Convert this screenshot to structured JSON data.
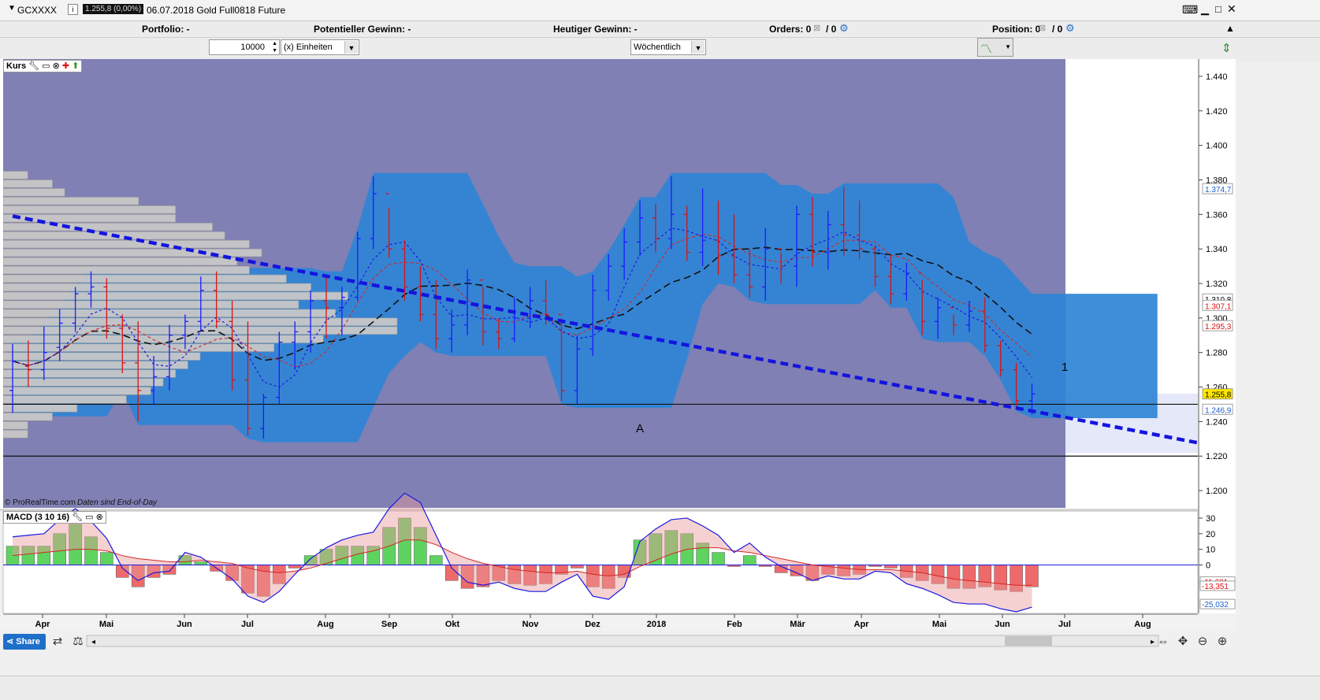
{
  "header": {
    "symbol": "GCXXXX",
    "price_badge": "1.255,8 (0,00%)",
    "instrument": "06.07.2018 Gold Full0818 Future"
  },
  "infobar": {
    "portfolio": "Portfolio: -",
    "potential": "Potentieller Gewinn: -",
    "today": "Heutiger Gewinn: -",
    "orders_label": "Orders: 0",
    "orders_sep": "/ 0",
    "position_label": "Position: 0",
    "position_sep": "/ 0"
  },
  "controls": {
    "quantity": "10000",
    "unit": "(x) Einheiten",
    "interval": "Wöchentlich"
  },
  "price_panel": {
    "label": "Kurs",
    "copyright": "© ProRealTime.com",
    "eod_note": "Daten sind End-of-Day",
    "annotation_a": "A",
    "annotation_1": "1"
  },
  "macd_panel": {
    "label": "MACD (3 10 16)"
  },
  "bottom": {
    "share": "Share"
  },
  "colors": {
    "chart_bg": "#8080b4",
    "cloud": "#2f84d6",
    "bull_bar": "#1a1aff",
    "bear_bar": "#dd1111",
    "trendline": "#1414e0",
    "macd_pos": "#5fd35f",
    "macd_neg": "#ee6a6a"
  },
  "chart_data": [
    {
      "type": "bar",
      "name": "price",
      "interval": "weekly",
      "ylim": [
        1190,
        1450
      ],
      "y_ticks": [
        "1.200",
        "1.220",
        "1.240",
        "1.260",
        "1.280",
        "1.300",
        "1.320",
        "1.340",
        "1.360",
        "1.380",
        "1.400",
        "1.420",
        "1.440"
      ],
      "x_labels": [
        "Apr",
        "Mai",
        "Jun",
        "Jul",
        "Aug",
        "Sep",
        "Okt",
        "Nov",
        "Dez",
        "2018",
        "Feb",
        "Mär",
        "Apr",
        "Mai",
        "Jun",
        "Jul",
        "Aug"
      ],
      "price_labels": [
        {
          "text": "1.374,7",
          "value": 1374.7,
          "color": "#1c5fd0"
        },
        {
          "text": "1.310,8",
          "value": 1310.8,
          "color": "#000000"
        },
        {
          "text": "1.307,1",
          "value": 1307.1,
          "color": "#dd1111"
        },
        {
          "text": "1.295,3",
          "value": 1295.3,
          "color": "#dd1111"
        },
        {
          "text": "1.255,8",
          "value": 1255.8,
          "color": "#000000",
          "highlight": "#ffe800"
        },
        {
          "text": "1.246,9",
          "value": 1246.9,
          "color": "#1c5fd0"
        }
      ],
      "horizontal_lines": [
        1250,
        1220
      ],
      "trendline": [
        {
          "x": 0,
          "y": 1359
        },
        {
          "x": 76,
          "y": 1227
        }
      ],
      "bars": [
        [
          1258,
          1285,
          1245,
          1275
        ],
        [
          1272,
          1287,
          1260,
          1270
        ],
        [
          1270,
          1295,
          1264,
          1280
        ],
        [
          1283,
          1305,
          1275,
          1297
        ],
        [
          1297,
          1318,
          1292,
          1314
        ],
        [
          1314,
          1327,
          1306,
          1318
        ],
        [
          1318,
          1323,
          1288,
          1294
        ],
        [
          1294,
          1302,
          1268,
          1274
        ],
        [
          1274,
          1298,
          1240,
          1258
        ],
        [
          1258,
          1278,
          1250,
          1266
        ],
        [
          1266,
          1296,
          1258,
          1290
        ],
        [
          1290,
          1302,
          1282,
          1298
        ],
        [
          1298,
          1324,
          1292,
          1316
        ],
        [
          1316,
          1327,
          1294,
          1298
        ],
        [
          1298,
          1310,
          1258,
          1264
        ],
        [
          1264,
          1298,
          1232,
          1236
        ],
        [
          1236,
          1256,
          1230,
          1254
        ],
        [
          1254,
          1292,
          1250,
          1286
        ],
        [
          1286,
          1298,
          1270,
          1292
        ],
        [
          1292,
          1316,
          1280,
          1310
        ],
        [
          1310,
          1325,
          1288,
          1306
        ],
        [
          1306,
          1318,
          1290,
          1312
        ],
        [
          1312,
          1350,
          1310,
          1346
        ],
        [
          1346,
          1382,
          1340,
          1372
        ],
        [
          1372,
          1364,
          1335,
          1340
        ],
        [
          1340,
          1345,
          1310,
          1318
        ],
        [
          1318,
          1330,
          1298,
          1302
        ],
        [
          1302,
          1322,
          1282,
          1288
        ],
        [
          1288,
          1305,
          1280,
          1296
        ],
        [
          1296,
          1328,
          1290,
          1322
        ],
        [
          1322,
          1318,
          1284,
          1292
        ],
        [
          1292,
          1300,
          1282,
          1288
        ],
        [
          1288,
          1312,
          1286,
          1300
        ],
        [
          1300,
          1318,
          1294,
          1310
        ],
        [
          1310,
          1322,
          1296,
          1302
        ],
        [
          1302,
          1300,
          1252,
          1258
        ],
        [
          1258,
          1290,
          1250,
          1282
        ],
        [
          1282,
          1325,
          1278,
          1316
        ],
        [
          1316,
          1337,
          1310,
          1330
        ],
        [
          1330,
          1352,
          1322,
          1344
        ],
        [
          1344,
          1368,
          1336,
          1358
        ],
        [
          1358,
          1366,
          1338,
          1346
        ],
        [
          1346,
          1382,
          1340,
          1360
        ],
        [
          1360,
          1365,
          1333,
          1338
        ],
        [
          1338,
          1375,
          1330,
          1345
        ],
        [
          1345,
          1368,
          1325,
          1336
        ],
        [
          1336,
          1360,
          1320,
          1325
        ],
        [
          1325,
          1340,
          1312,
          1318
        ],
        [
          1318,
          1352,
          1310,
          1340
        ],
        [
          1340,
          1338,
          1320,
          1330
        ],
        [
          1330,
          1365,
          1318,
          1360
        ],
        [
          1360,
          1370,
          1330,
          1338
        ],
        [
          1338,
          1362,
          1328,
          1354
        ],
        [
          1354,
          1376,
          1336,
          1348
        ],
        [
          1348,
          1368,
          1334,
          1340
        ],
        [
          1340,
          1342,
          1318,
          1324
        ],
        [
          1324,
          1336,
          1308,
          1314
        ],
        [
          1314,
          1332,
          1310,
          1326
        ],
        [
          1326,
          1322,
          1290,
          1298
        ],
        [
          1298,
          1312,
          1288,
          1306
        ],
        [
          1306,
          1302,
          1290,
          1296
        ],
        [
          1296,
          1310,
          1292,
          1304
        ],
        [
          1304,
          1312,
          1280,
          1284
        ],
        [
          1284,
          1287,
          1266,
          1270
        ],
        [
          1270,
          1274,
          1248,
          1252
        ],
        [
          1252,
          1262,
          1244,
          1256
        ]
      ]
    },
    {
      "type": "bar",
      "name": "MACD (3 10 16)",
      "ylim": [
        -30,
        33
      ],
      "y_ticks": [
        "30",
        "20",
        "10",
        "0"
      ],
      "value_labels": [
        {
          "text": "-11,681",
          "value": -11.681,
          "color": "#dd1111"
        },
        {
          "text": "-13,351",
          "value": -13.351,
          "color": "#dd1111"
        },
        {
          "text": "-25,032",
          "value": -25.032,
          "color": "#1c5fd0"
        }
      ],
      "histogram": [
        12,
        12,
        12,
        20,
        26,
        18,
        8,
        -8,
        -14,
        -8,
        -6,
        6,
        2,
        -4,
        -10,
        -18,
        -20,
        -12,
        -2,
        6,
        10,
        12,
        12,
        12,
        24,
        30,
        24,
        6,
        -10,
        -15,
        -14,
        -10,
        -12,
        -13,
        -12,
        -6,
        -2,
        -14,
        -15,
        -8,
        16,
        20,
        22,
        20,
        14,
        8,
        -1,
        6,
        -1,
        -5,
        -7,
        -10,
        -6,
        -7,
        -6,
        -1,
        -2,
        -8,
        -10,
        -12,
        -15,
        -15,
        -14,
        -16,
        -17,
        -14
      ],
      "signal": [
        6,
        7,
        8,
        9,
        10,
        10,
        9,
        6,
        4,
        3,
        2,
        2,
        3,
        2,
        1,
        -2,
        -4,
        -5,
        -4,
        -2,
        1,
        4,
        7,
        9,
        12,
        16,
        16,
        13,
        8,
        4,
        1,
        -1,
        -3,
        -4,
        -5,
        -5,
        -4,
        -6,
        -7,
        -6,
        -1,
        3,
        7,
        10,
        11,
        11,
        9,
        8,
        6,
        4,
        2,
        0,
        -1,
        -2,
        -3,
        -3,
        -3,
        -4,
        -5,
        -7,
        -9,
        -10,
        -11,
        -12,
        -13,
        -13
      ],
      "macd": [
        18,
        19,
        20,
        29,
        36,
        28,
        17,
        -2,
        -10,
        -5,
        -4,
        8,
        5,
        -2,
        -9,
        -20,
        -24,
        -17,
        -6,
        4,
        11,
        16,
        19,
        21,
        36,
        46,
        40,
        19,
        -2,
        -11,
        -13,
        -11,
        -15,
        -17,
        -17,
        -11,
        -6,
        -20,
        -22,
        -14,
        15,
        23,
        29,
        30,
        25,
        19,
        8,
        14,
        5,
        -1,
        -5,
        -10,
        -7,
        -9,
        -9,
        -4,
        -5,
        -12,
        -15,
        -19,
        -24,
        -25,
        -25,
        -28,
        -30,
        -27
      ]
    }
  ]
}
